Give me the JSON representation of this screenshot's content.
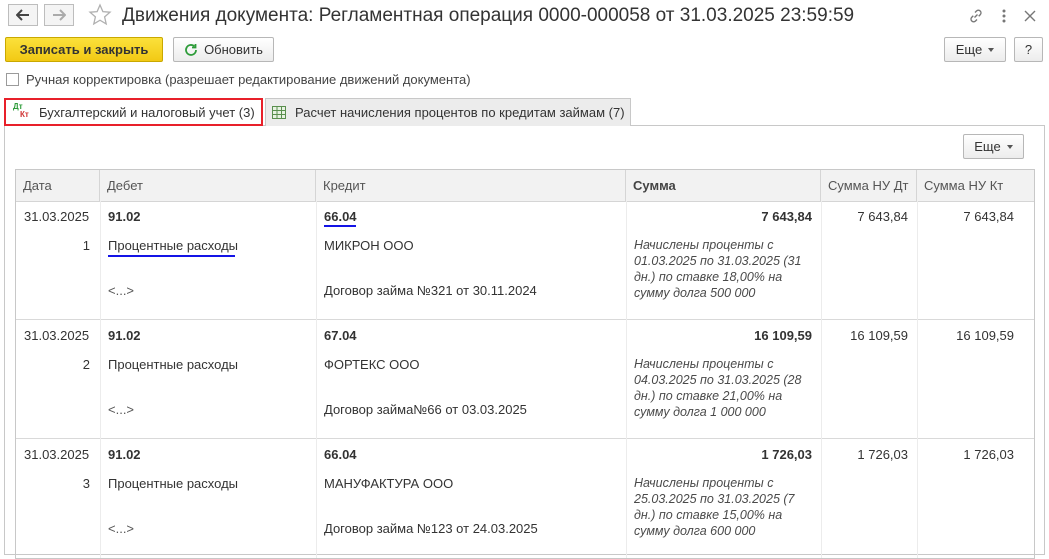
{
  "window": {
    "title": "Движения документа: Регламентная операция 0000-000058 от 31.03.2025 23:59:59",
    "icons": [
      "back-arrow-icon",
      "forward-arrow-icon",
      "star-icon",
      "link-icon",
      "more-vertical-icon",
      "close-icon"
    ]
  },
  "toolbar": {
    "save_close_label": "Записать и закрыть",
    "refresh_label": "Обновить",
    "more_label": "Еще",
    "help_label": "?"
  },
  "manual_adjust_label": "Ручная корректировка (разрешает редактирование движений документа)",
  "tabs": [
    {
      "label": "Бухгалтерский и налоговый учет (3)",
      "icon": "dt-kt-icon",
      "active": true
    },
    {
      "label": "Расчет начисления процентов по кредитам займам (7)",
      "icon": "table-icon",
      "active": false
    }
  ],
  "table_more_label": "Еще",
  "columns": [
    "Дата",
    "Дебет",
    "Кредит",
    "Сумма",
    "Сумма НУ Дт",
    "Сумма НУ Кт"
  ],
  "rows": [
    {
      "date": "31.03.2025",
      "num": "1",
      "debit": "91.02",
      "debit_sub": "Процентные расходы",
      "debit_sub2": "<...>",
      "credit": "66.04",
      "credit_sub": "МИКРОН ООО",
      "credit_sub2": "Договор займа №321 от 30.11.2024",
      "sum": "7 643,84",
      "sum_nu_dt": "7 643,84",
      "sum_nu_kt": "7 643,84",
      "content": "Начислены проценты с 01.03.2025 по 31.03.2025 (31 дн.) по ставке 18,00% на сумму долга 500 000"
    },
    {
      "date": "31.03.2025",
      "num": "2",
      "debit": "91.02",
      "debit_sub": "Процентные расходы",
      "debit_sub2": "<...>",
      "credit": "67.04",
      "credit_sub": "ФОРТЕКС ООО",
      "credit_sub2": "Договор займа№66 от 03.03.2025",
      "sum": "16 109,59",
      "sum_nu_dt": "16 109,59",
      "sum_nu_kt": "16 109,59",
      "content": "Начислены проценты с 04.03.2025 по 31.03.2025 (28 дн.) по ставке 21,00% на сумму долга 1 000 000"
    },
    {
      "date": "31.03.2025",
      "num": "3",
      "debit": "91.02",
      "debit_sub": "Процентные расходы",
      "debit_sub2": "<...>",
      "credit": "66.04",
      "credit_sub": "МАНУФАКТУРА ООО",
      "credit_sub2": "Договор займа №123 от 24.03.2025",
      "sum": "1 726,03",
      "sum_nu_dt": "1 726,03",
      "sum_nu_kt": "1 726,03",
      "content": "Начислены проценты с 25.03.2025 по 31.03.2025 (7 дн.) по ставке 15,00% на сумму долга 600 000"
    }
  ],
  "colors": {
    "primary_button": "#f5d11f",
    "active_tab_border": "#e8202a",
    "highlight_underline": "#1414e6"
  }
}
